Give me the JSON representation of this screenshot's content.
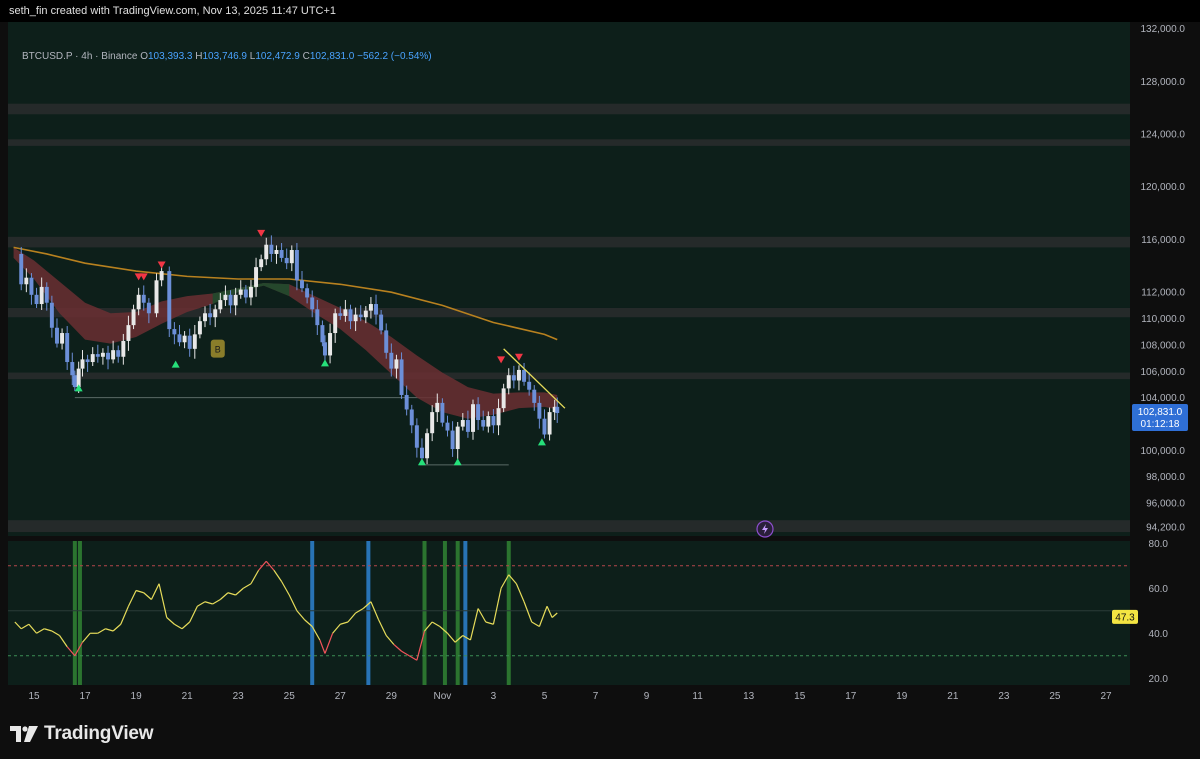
{
  "header": {
    "attribution": "seth_fin created with TradingView.com, Nov 13, 2025 11:47 UTC+1"
  },
  "legend": {
    "symbol": "BTCUSD.P · 4h · Binance",
    "o_label": "O",
    "o_value": "103,393.3",
    "h_label": "H",
    "h_value": "103,746.9",
    "l_label": "L",
    "l_value": "102,472.9",
    "c_label": "C",
    "c_value": "102,831.0",
    "change": "−562.2 (−0.54%)"
  },
  "brand": {
    "name": "TradingView"
  },
  "colors": {
    "background": "#0e0e0e",
    "pane": "#0d1f1a",
    "zone": "#2a2d2e",
    "candle_up": "#e8e8e8",
    "candle_down": "#6c8fd8",
    "ema": "#b8811f",
    "ribbon_bear": "#6b2f33",
    "ribbon_bull": "#1f4a2c",
    "trendline": "#e6dc5a",
    "rsi_line": "#e6dc5a",
    "rsi_hot": "#f2545b",
    "marker_up": "#26e07a",
    "marker_down": "#f23645",
    "price_label": "#2f6fd6",
    "rsi_label": "#f4e542",
    "bar_green": "#2f7d32",
    "bar_blue": "#2b7cc7",
    "accent_b": "#8a7d2a"
  },
  "chart_data": {
    "type": "candlestick",
    "instrument": "BTCUSD.P",
    "timeframe": "4h",
    "exchange": "Binance",
    "price_axis": {
      "ylim": [
        93500,
        132500
      ],
      "ticks": [
        "132,000.0",
        "128,000.0",
        "124,000.0",
        "120,000.0",
        "116,000.0",
        "112,000.0",
        "110,000.0",
        "108,000.0",
        "106,000.0",
        "104,000.0",
        "100,000.0",
        "98,000.0",
        "96,000.0",
        "94,200.0"
      ],
      "tick_values": [
        132000,
        128000,
        124000,
        120000,
        116000,
        112000,
        110000,
        108000,
        106000,
        104000,
        100000,
        98000,
        96000,
        94200
      ]
    },
    "last_price": {
      "value": 102831.0,
      "label": "102,831.0",
      "countdown": "01:12:18"
    },
    "x_axis": {
      "xlim": [
        14.2,
        28.1
      ],
      "ticks": [
        "15",
        "17",
        "19",
        "21",
        "23",
        "25",
        "27",
        "29",
        "Nov",
        "3",
        "5",
        "7",
        "9",
        "11",
        "13",
        "15",
        "17",
        "19",
        "21",
        "23",
        "25",
        "27"
      ],
      "tick_x": [
        15,
        17,
        19,
        21,
        23,
        25,
        27,
        29,
        31,
        33,
        35,
        37,
        39,
        41,
        43,
        45,
        47,
        49,
        51,
        53,
        55,
        57
      ]
    },
    "close_path": [
      [
        14.25,
        114900
      ],
      [
        14.5,
        112600
      ],
      [
        14.7,
        113100
      ],
      [
        14.9,
        111800
      ],
      [
        15.1,
        111100
      ],
      [
        15.3,
        112400
      ],
      [
        15.5,
        111200
      ],
      [
        15.7,
        109300
      ],
      [
        15.9,
        108100
      ],
      [
        16.1,
        108900
      ],
      [
        16.3,
        106700
      ],
      [
        16.5,
        105700
      ],
      [
        16.6,
        104800
      ],
      [
        16.75,
        106200
      ],
      [
        16.9,
        106900
      ],
      [
        17.1,
        106700
      ],
      [
        17.3,
        107300
      ],
      [
        17.5,
        107100
      ],
      [
        17.7,
        107400
      ],
      [
        17.9,
        106900
      ],
      [
        18.1,
        107600
      ],
      [
        18.3,
        107100
      ],
      [
        18.5,
        108300
      ],
      [
        18.7,
        109500
      ],
      [
        18.9,
        110700
      ],
      [
        19.1,
        111800
      ],
      [
        19.3,
        111200
      ],
      [
        19.5,
        110400
      ],
      [
        19.8,
        112900
      ],
      [
        20.0,
        113600
      ],
      [
        20.3,
        109200
      ],
      [
        20.5,
        108800
      ],
      [
        20.7,
        108200
      ],
      [
        20.9,
        108700
      ],
      [
        21.1,
        107700
      ],
      [
        21.3,
        108800
      ],
      [
        21.5,
        109800
      ],
      [
        21.7,
        110400
      ],
      [
        21.9,
        110100
      ],
      [
        22.1,
        110700
      ],
      [
        22.3,
        111400
      ],
      [
        22.5,
        111800
      ],
      [
        22.7,
        111000
      ],
      [
        22.9,
        111800
      ],
      [
        23.1,
        112200
      ],
      [
        23.3,
        111600
      ],
      [
        23.5,
        112400
      ],
      [
        23.7,
        113900
      ],
      [
        23.9,
        114500
      ],
      [
        24.1,
        115600
      ],
      [
        24.3,
        114900
      ],
      [
        24.5,
        115200
      ],
      [
        24.7,
        114600
      ],
      [
        24.9,
        114200
      ],
      [
        25.1,
        115200
      ],
      [
        25.3,
        112900
      ],
      [
        25.5,
        112300
      ],
      [
        25.7,
        111600
      ],
      [
        25.9,
        110700
      ],
      [
        26.1,
        109500
      ],
      [
        26.3,
        108200
      ],
      [
        26.4,
        107200
      ],
      [
        26.6,
        108900
      ],
      [
        26.8,
        110400
      ],
      [
        27.0,
        110200
      ],
      [
        27.2,
        110700
      ],
      [
        27.4,
        109800
      ],
      [
        27.6,
        110300
      ],
      [
        27.8,
        110100
      ],
      [
        28.0,
        110600
      ],
      [
        28.2,
        111100
      ],
      [
        28.4,
        110300
      ],
      [
        28.6,
        109100
      ],
      [
        28.8,
        107400
      ],
      [
        29.0,
        106200
      ],
      [
        29.2,
        106900
      ],
      [
        29.4,
        104200
      ],
      [
        29.6,
        103100
      ],
      [
        29.8,
        101900
      ],
      [
        30.0,
        100200
      ],
      [
        30.2,
        99400
      ],
      [
        30.4,
        101300
      ],
      [
        30.6,
        102900
      ],
      [
        30.8,
        103600
      ],
      [
        31.0,
        102100
      ],
      [
        31.2,
        101500
      ],
      [
        31.4,
        100100
      ],
      [
        31.6,
        101800
      ],
      [
        31.8,
        102300
      ],
      [
        32.0,
        101400
      ],
      [
        32.2,
        103500
      ],
      [
        32.4,
        102300
      ],
      [
        32.6,
        101800
      ],
      [
        32.8,
        102600
      ],
      [
        33.0,
        101900
      ],
      [
        33.2,
        103200
      ],
      [
        33.4,
        104700
      ],
      [
        33.6,
        105700
      ],
      [
        33.8,
        105300
      ],
      [
        34.0,
        106100
      ],
      [
        34.2,
        105200
      ],
      [
        34.4,
        104600
      ],
      [
        34.6,
        103600
      ],
      [
        34.8,
        102400
      ],
      [
        35.0,
        101200
      ],
      [
        35.2,
        102900
      ],
      [
        35.4,
        103300
      ],
      [
        35.5,
        102831
      ]
    ],
    "ema_200": [
      [
        14.2,
        115400
      ],
      [
        15.5,
        114900
      ],
      [
        17,
        114200
      ],
      [
        19,
        113600
      ],
      [
        21,
        113200
      ],
      [
        23,
        113000
      ],
      [
        25,
        113000
      ],
      [
        27,
        112600
      ],
      [
        29,
        112000
      ],
      [
        31,
        111000
      ],
      [
        33,
        109700
      ],
      [
        35,
        108800
      ],
      [
        35.5,
        108400
      ]
    ],
    "ribbon_upper": [
      [
        14.2,
        115400
      ],
      [
        15,
        114400
      ],
      [
        16,
        112800
      ],
      [
        17,
        111200
      ],
      [
        18,
        110400
      ],
      [
        19,
        110500
      ],
      [
        20,
        111300
      ],
      [
        21,
        111700
      ],
      [
        22,
        111900
      ],
      [
        23,
        112300
      ],
      [
        24,
        112700
      ],
      [
        25,
        112600
      ],
      [
        26,
        111700
      ],
      [
        27,
        110800
      ],
      [
        28,
        109800
      ],
      [
        29,
        108600
      ],
      [
        30,
        107200
      ],
      [
        31,
        105900
      ],
      [
        32,
        104800
      ],
      [
        33,
        104300
      ],
      [
        34,
        104400
      ],
      [
        35,
        104400
      ],
      [
        35.5,
        104200
      ]
    ],
    "ribbon_lower": [
      [
        14.2,
        114600
      ],
      [
        15,
        113000
      ],
      [
        16,
        110400
      ],
      [
        17,
        108400
      ],
      [
        18,
        108100
      ],
      [
        19,
        108600
      ],
      [
        20,
        109600
      ],
      [
        21,
        110500
      ],
      [
        22,
        111100
      ],
      [
        23,
        112000
      ],
      [
        24,
        112500
      ],
      [
        25,
        111700
      ],
      [
        26,
        110400
      ],
      [
        27,
        109200
      ],
      [
        28,
        107600
      ],
      [
        29,
        105800
      ],
      [
        30,
        104000
      ],
      [
        31,
        102900
      ],
      [
        32,
        102400
      ],
      [
        33,
        102700
      ],
      [
        34,
        103200
      ],
      [
        35,
        103300
      ],
      [
        35.5,
        103100
      ]
    ],
    "resistance_zones": [
      [
        125500,
        126300
      ],
      [
        123100,
        123600
      ],
      [
        115400,
        116200
      ],
      [
        110100,
        110800
      ],
      [
        105400,
        105900
      ],
      [
        93800,
        94700
      ]
    ],
    "support_lines": [
      [
        16.6,
        104000,
        30.9,
        104000
      ],
      [
        30.1,
        98900,
        33.6,
        98900
      ]
    ],
    "trendline": [
      [
        33.4,
        107700
      ],
      [
        35.8,
        103200
      ]
    ],
    "markers_up": [
      [
        16.75,
        104700
      ],
      [
        20.55,
        106500
      ],
      [
        26.4,
        106600
      ],
      [
        30.2,
        99100
      ],
      [
        31.6,
        99100
      ],
      [
        34.9,
        100600
      ]
    ],
    "markers_down": [
      [
        19.1,
        113200
      ],
      [
        19.3,
        113200
      ],
      [
        20.0,
        114100
      ],
      [
        23.9,
        116500
      ],
      [
        33.3,
        106900
      ],
      [
        34.0,
        107100
      ]
    ],
    "label_b": {
      "text": "B",
      "x": 22.2,
      "y": 108400
    },
    "rsi": {
      "ylim": [
        17,
        81
      ],
      "ticks": [
        "80.0",
        "60.0",
        "40.0",
        "20.0"
      ],
      "tick_values": [
        80,
        60,
        40,
        20
      ],
      "overbought": 70,
      "oversold": 30,
      "mid": 50,
      "value_label": "47.3",
      "values": [
        [
          14.25,
          45
        ],
        [
          14.5,
          42
        ],
        [
          14.8,
          44
        ],
        [
          15.1,
          40
        ],
        [
          15.4,
          42
        ],
        [
          15.7,
          41
        ],
        [
          16.0,
          39
        ],
        [
          16.3,
          34
        ],
        [
          16.6,
          30
        ],
        [
          16.9,
          36
        ],
        [
          17.2,
          40
        ],
        [
          17.5,
          40
        ],
        [
          17.8,
          42
        ],
        [
          18.1,
          41
        ],
        [
          18.4,
          44
        ],
        [
          18.7,
          52
        ],
        [
          19.0,
          59
        ],
        [
          19.3,
          58
        ],
        [
          19.6,
          55
        ],
        [
          19.9,
          62
        ],
        [
          20.2,
          47
        ],
        [
          20.5,
          44
        ],
        [
          20.8,
          42
        ],
        [
          21.1,
          45
        ],
        [
          21.4,
          52
        ],
        [
          21.7,
          54
        ],
        [
          22.0,
          53
        ],
        [
          22.3,
          55
        ],
        [
          22.6,
          58
        ],
        [
          22.9,
          57
        ],
        [
          23.2,
          60
        ],
        [
          23.5,
          62
        ],
        [
          23.8,
          68
        ],
        [
          24.1,
          72
        ],
        [
          24.4,
          68
        ],
        [
          24.7,
          63
        ],
        [
          25.0,
          57
        ],
        [
          25.3,
          50
        ],
        [
          25.6,
          46
        ],
        [
          25.9,
          43
        ],
        [
          26.2,
          37
        ],
        [
          26.4,
          31
        ],
        [
          26.7,
          40
        ],
        [
          27.0,
          44
        ],
        [
          27.3,
          45
        ],
        [
          27.6,
          49
        ],
        [
          27.9,
          51
        ],
        [
          28.2,
          54
        ],
        [
          28.5,
          46
        ],
        [
          28.8,
          39
        ],
        [
          29.1,
          35
        ],
        [
          29.4,
          32
        ],
        [
          29.7,
          30
        ],
        [
          30.0,
          28
        ],
        [
          30.3,
          41
        ],
        [
          30.6,
          45
        ],
        [
          30.9,
          43
        ],
        [
          31.2,
          40
        ],
        [
          31.5,
          36
        ],
        [
          31.8,
          39
        ],
        [
          32.1,
          37
        ],
        [
          32.4,
          51
        ],
        [
          32.7,
          45
        ],
        [
          33.0,
          44
        ],
        [
          33.3,
          60
        ],
        [
          33.6,
          66
        ],
        [
          33.9,
          62
        ],
        [
          34.2,
          54
        ],
        [
          34.5,
          45
        ],
        [
          34.8,
          43
        ],
        [
          35.1,
          52
        ],
        [
          35.3,
          47
        ],
        [
          35.5,
          49
        ]
      ]
    },
    "signal_bars_green": [
      16.6,
      16.8,
      30.3,
      31.1,
      31.6,
      33.6
    ],
    "signal_bars_blue": [
      25.9,
      28.1,
      31.9
    ]
  }
}
